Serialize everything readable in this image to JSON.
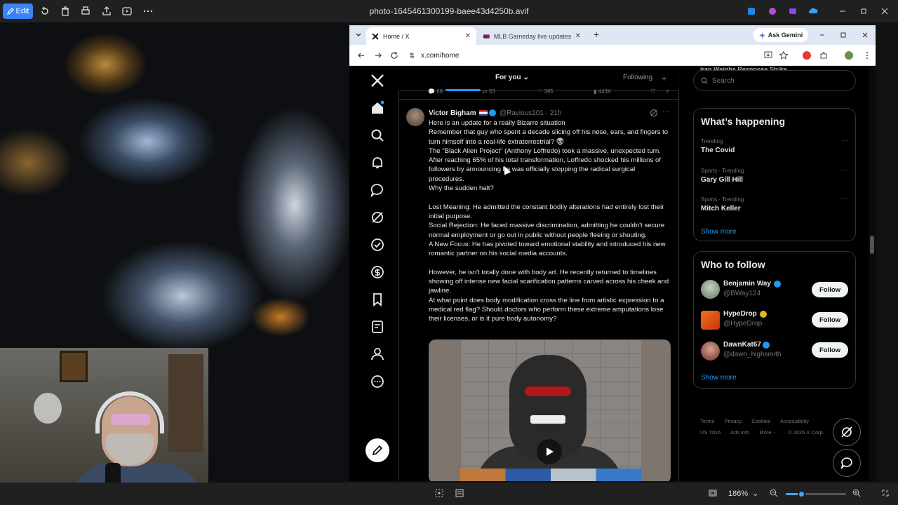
{
  "photos_app": {
    "edit_label": "Edit",
    "title": "photo-1645461300199-baee43d4250b.avif",
    "zoom": "186%"
  },
  "browser": {
    "tabs": [
      {
        "label": "Home / X"
      },
      {
        "label": "MLB Gameday live updates: Pir"
      }
    ],
    "gemini_label": "Ask Gemini",
    "url": "x.com/home"
  },
  "timeline": {
    "tab_foryou": "For you",
    "tab_following": "Following",
    "prev_stats": [
      "68",
      "53",
      "395",
      "443K"
    ],
    "post": {
      "name": "Victor Bigham",
      "handle": "@Ravious101 · 21h",
      "body": "Here is an update for a really Bizarre situation\nRemember that guy who spent a decade slicing off his nose, ears, and fingers to turn himself into a real-life extraterrestrial? 👽\nThe \"Black Alien Project\" (Anthony Loffredo) took a massive, unexpected turn. After reaching 65% of his total transformation, Loffredo shocked his millions of followers by announcing he was officially stopping the radical surgical procedures.\nWhy the sudden halt?\n\nLost Meaning: He admitted the constant bodily alterations had entirely lost their initial purpose.\nSocial Rejection: He faced massive discrimination, admitting he couldn't secure normal employment or go out in public without people fleeing or shouting.\nA New Focus: He has pivoted toward emotional stability and introduced his new romantic partner on his social media accounts.\n\nHowever, he isn't totally done with body art. He recently returned to timelines showing off intense new facial scarification patterns carved across his cheek and jawline.\nAt what point does body modification cross the line from artistic expression to a medical red flag? Should doctors who perform these extreme amputations lose their licenses, or is it pure body autonomy?"
    }
  },
  "sidebar": {
    "top_cut_text": "Iran Weighs Response Strike",
    "search_placeholder": "Search",
    "happening_title": "What’s happening",
    "trends": [
      {
        "meta": "Trending",
        "name": "The Covid"
      },
      {
        "meta": "Sports · Trending",
        "name": "Gary Gill Hill"
      },
      {
        "meta": "Sports · Trending",
        "name": "Mitch Keller"
      }
    ],
    "show_more": "Show more",
    "follow_title": "Who to follow",
    "follow": [
      {
        "name": "Benjamin Way",
        "handle": "@BWay124",
        "button": "Follow",
        "badge": "#1d9bf0"
      },
      {
        "name": "HypeDrop",
        "handle": "@HypeDrop",
        "button": "Follow",
        "badge": "#e2b719"
      },
      {
        "name": "DawnKat67",
        "handle": "@dawn_highsmith",
        "button": "Follow",
        "badge": "#1d9bf0"
      }
    ],
    "footer": [
      "Terms",
      "Privacy",
      "Cookies",
      "Accessibility",
      "US TIDA",
      "Ads info",
      "More ···",
      "© 2026 X Corp."
    ]
  }
}
